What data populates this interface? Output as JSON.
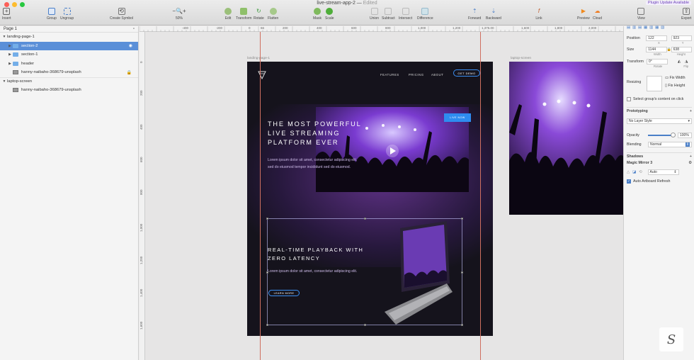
{
  "window": {
    "title": "live-stream-app-2",
    "status": "Edited",
    "plugin_badge": "Plugin Update Available"
  },
  "toolbar": {
    "insert": "Insert",
    "group": "Group",
    "ungroup": "Ungroup",
    "create_symbol": "Create Symbol",
    "zoom": "50%",
    "edit": "Edit",
    "transform": "Transform",
    "rotate": "Rotate",
    "flatten": "Flatten",
    "mask": "Mask",
    "scale": "Scale",
    "union": "Union",
    "subtract": "Subtract",
    "intersect": "Intersect",
    "difference": "Difference",
    "forward": "Forward",
    "backward": "Backward",
    "link": "Link",
    "preview": "Preview",
    "cloud": "Cloud",
    "view": "View",
    "export": "Export"
  },
  "layers": {
    "page": "Page 1",
    "items": [
      {
        "label": "landing-page-1"
      },
      {
        "label": "section-2"
      },
      {
        "label": "section-1"
      },
      {
        "label": "header"
      },
      {
        "label": "hanny-naibaho-368679-unsplash"
      },
      {
        "label": "laptop-screen"
      },
      {
        "label": "hanny-naibaho-368679-unsplash"
      }
    ]
  },
  "ruler": {
    "top": [
      "-400",
      "-200",
      "0",
      "66",
      "200",
      "400",
      "600",
      "800",
      "1,000",
      "1,200",
      "1,376.00",
      "1,600",
      "1,800",
      "2,000"
    ],
    "left": [
      "0",
      "200",
      "400",
      "600",
      "800",
      "1,000",
      "1,200",
      "1,400",
      "1,600"
    ]
  },
  "artboards": {
    "landing": "landing-page-1",
    "laptop": "laptop-screen"
  },
  "design": {
    "nav": [
      "FEATURES",
      "PRICING",
      "ABOUT"
    ],
    "get_demo": "GET DEMO",
    "hero_title": "THE MOST POWERFUL LIVE STREAMING PLATFORM EVER",
    "hero_text": "Lorem ipsum dolor sit amet, consectetur adipiscing elit, sed do eiusmod tempor incididunt sed do eiusmod.",
    "live_button": "LIVE NOW",
    "section_title": "REAL-TIME PLAYBACK WITH ZERO LATENCY",
    "section_text": "Lorem ipsum dolor sit amet, consectetur adipiscing elit.",
    "learn_more": "LEARN MORE"
  },
  "inspector": {
    "position_label": "Position",
    "x": "122",
    "y": "923",
    "x_label": "X",
    "y_label": "Y",
    "size_label": "Size",
    "width": "1144",
    "height": "638",
    "width_label": "Width",
    "height_label": "Height",
    "transform_label": "Transform",
    "rotate": "0°",
    "rotate_label": "Rotate",
    "flip_label": "Flip",
    "resizing_label": "Resizing",
    "fix_width": "Fix Width",
    "fix_height": "Fix Height",
    "select_group": "Select group's content on click",
    "prototyping": "Prototyping",
    "no_layer_style": "No Layer Style",
    "opacity_label": "Opacity",
    "opacity": "100%",
    "opacity_value": 1.0,
    "blending_label": "Blending",
    "blending": "Normal",
    "shadows": "Shadows",
    "magic_mirror": "Magic Mirror 3",
    "auto": "Auto",
    "auto_refresh": "Auto Artboard Refresh"
  },
  "colors": {
    "accent": "#2e8cf0",
    "selection": "#5a8fd8",
    "guide": "#d07060",
    "artboard_bg": "#15131c"
  }
}
